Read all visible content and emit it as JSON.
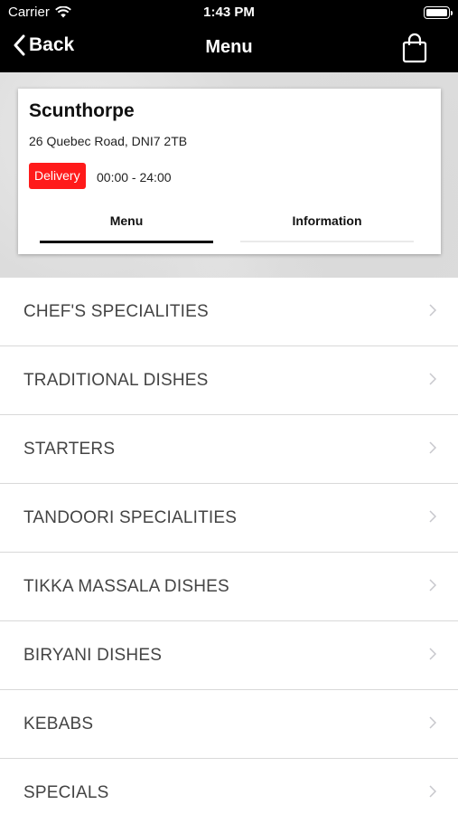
{
  "status_bar": {
    "carrier": "Carrier",
    "time": "1:43 PM"
  },
  "nav": {
    "back_label": "Back",
    "title": "Menu",
    "cart_icon": "shopping-bag-icon"
  },
  "restaurant": {
    "name": "Scunthorpe",
    "address": "26 Quebec Road, DNI7 2TB",
    "badge": "Delivery",
    "hours": "00:00 - 24:00",
    "tabs": [
      {
        "label": "Menu",
        "active": true
      },
      {
        "label": "Information",
        "active": false
      }
    ]
  },
  "menu": {
    "items": [
      {
        "label": "CHEF'S SPECIALITIES"
      },
      {
        "label": "TRADITIONAL DISHES"
      },
      {
        "label": "STARTERS"
      },
      {
        "label": "TANDOORI SPECIALITIES"
      },
      {
        "label": "TIKKA MASSALA DISHES"
      },
      {
        "label": "BIRYANI DISHES"
      },
      {
        "label": "KEBABS"
      },
      {
        "label": "SPECIALS"
      }
    ]
  },
  "colors": {
    "badge": "#ff1a1a",
    "nav_bg": "#000000",
    "text": "#444444"
  }
}
